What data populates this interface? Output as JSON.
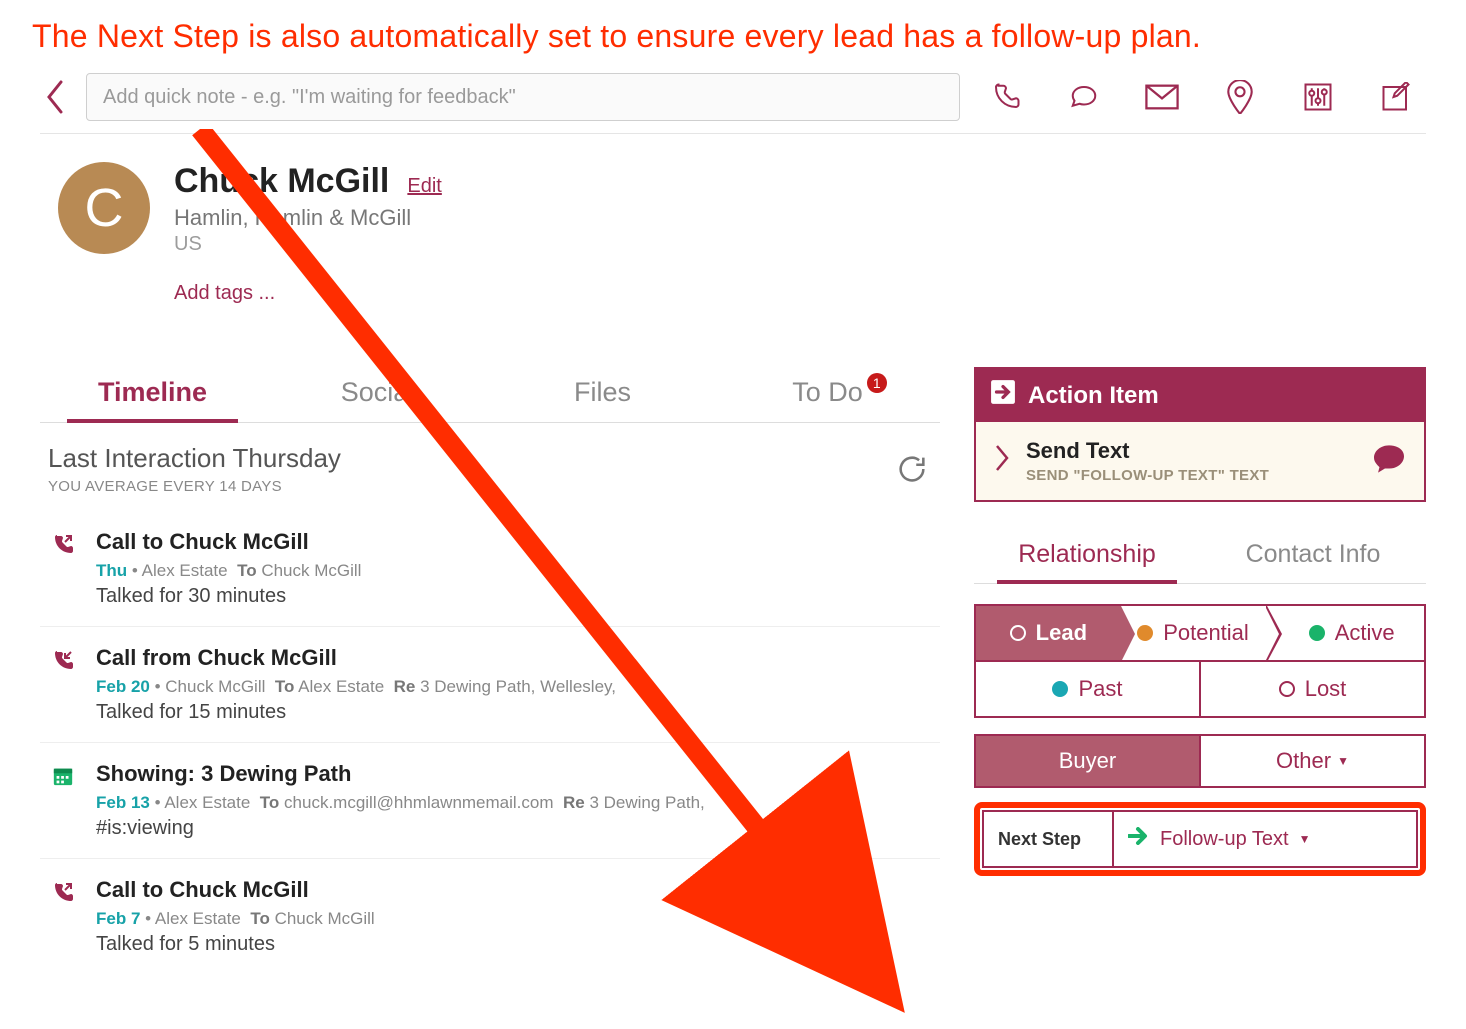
{
  "annotation": "The Next Step is also automatically set to ensure every lead has a follow-up plan.",
  "quicknote": {
    "placeholder": "Add quick note - e.g. \"I'm waiting for feedback\""
  },
  "contact": {
    "initial": "C",
    "name": "Chuck McGill",
    "edit": "Edit",
    "company": "Hamlin, Hamlin & McGill",
    "country": "US",
    "add_tags": "Add tags ..."
  },
  "tabs": {
    "timeline": "Timeline",
    "social": "Social",
    "files": "Files",
    "todo": "To Do",
    "todo_count": "1"
  },
  "last_interaction": {
    "title": "Last Interaction Thursday",
    "sub": "YOU AVERAGE EVERY 14 DAYS"
  },
  "timeline": [
    {
      "icon": "call-out",
      "title": "Call to Chuck McGill",
      "date": "Thu",
      "sep": " • ",
      "from": "Alex Estate",
      "to_lbl": "To",
      "to": "Chuck McGill",
      "re_lbl": "",
      "re": "",
      "detail": "Talked for 30 minutes"
    },
    {
      "icon": "call-in",
      "title": "Call from Chuck McGill",
      "date": "Feb 20",
      "sep": " • ",
      "from": "Chuck McGill",
      "to_lbl": "To",
      "to": "Alex Estate",
      "re_lbl": "Re",
      "re": "3 Dewing Path, Wellesley,",
      "detail": "Talked for 15 minutes"
    },
    {
      "icon": "calendar",
      "title": "Showing: 3 Dewing Path",
      "date": "Feb 13",
      "sep": " • ",
      "from": "Alex Estate",
      "to_lbl": "To",
      "to": "chuck.mcgill@hhmlawnmemail.com",
      "re_lbl": "Re",
      "re": "3 Dewing Path,",
      "detail": "#is:viewing"
    },
    {
      "icon": "call-out",
      "title": "Call to Chuck McGill",
      "date": "Feb 7",
      "sep": " • ",
      "from": "Alex Estate",
      "to_lbl": "To",
      "to": "Chuck McGill",
      "re_lbl": "",
      "re": "",
      "detail": "Talked for 5 minutes"
    }
  ],
  "action_item": {
    "header": "Action Item",
    "title": "Send Text",
    "sub": "SEND \"FOLLOW-UP TEXT\" TEXT"
  },
  "subtabs": {
    "relationship": "Relationship",
    "contact_info": "Contact Info"
  },
  "status": {
    "lead": "Lead",
    "potential": "Potential",
    "active": "Active",
    "past": "Past",
    "lost": "Lost"
  },
  "roles": {
    "buyer": "Buyer",
    "other": "Other",
    "caret": "▼"
  },
  "next_step": {
    "label": "Next Step",
    "value": "Follow-up Text",
    "caret": "▼"
  }
}
